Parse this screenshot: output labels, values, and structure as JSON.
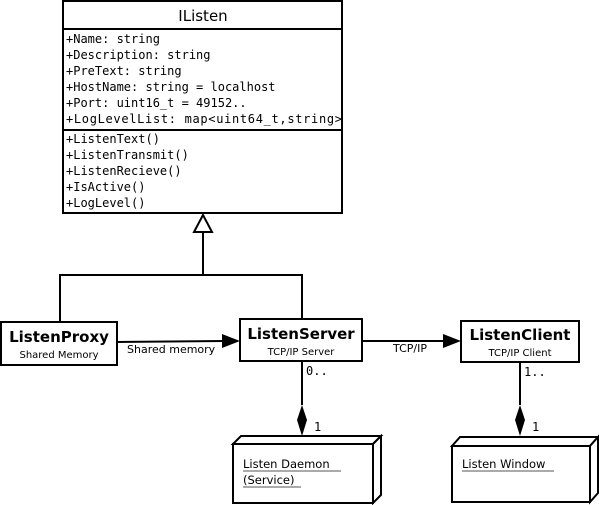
{
  "interface": {
    "name": "IListen",
    "attributes": [
      "+Name: string",
      "+Description: string",
      "+PreText: string",
      "+HostName: string = localhost",
      "+Port: uint16_t = 49152..",
      "+LogLevelList: map<uint64_t,string>"
    ],
    "methods": [
      "+ListenText()",
      "+ListenTransmit()",
      "+ListenRecieve()",
      "+IsActive()",
      "+LogLevel()"
    ]
  },
  "classes": {
    "proxy": {
      "name": "ListenProxy",
      "subtitle": "Shared Memory"
    },
    "server": {
      "name": "ListenServer",
      "subtitle": "TCP/IP Server"
    },
    "client": {
      "name": "ListenClient",
      "subtitle": "TCP/IP Client"
    }
  },
  "associations": {
    "proxy_server": "Shared memory",
    "server_client": "TCP/IP",
    "server_mult": "0..",
    "server_daemon_mult": "1",
    "client_mult": "1..",
    "client_window_mult": "1"
  },
  "nodes": {
    "daemon": {
      "line1": "Listen Daemon",
      "line2": "(Service)"
    },
    "window": {
      "line1": "Listen Window"
    }
  }
}
